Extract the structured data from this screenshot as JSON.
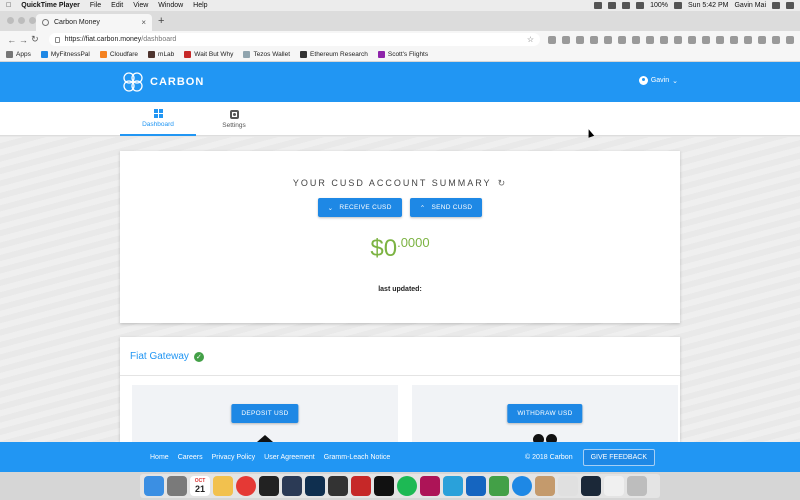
{
  "menubar": {
    "apple": "",
    "app_name": "QuickTime Player",
    "items": [
      "File",
      "Edit",
      "View",
      "Window",
      "Help"
    ],
    "battery": "100%",
    "clock": "Sun 5:42 PM",
    "user": "Gavin Mai"
  },
  "browser": {
    "tab_title": "Carbon Money",
    "tab_close": "×",
    "new_tab": "+",
    "url_host": "https://fiat.carbon.money",
    "url_path": "/dashboard",
    "bookmarks": [
      {
        "label": "Apps",
        "color": "#777777"
      },
      {
        "label": "MyFitnessPal",
        "color": "#1e88e5"
      },
      {
        "label": "Cloudfare",
        "color": "#f48120"
      },
      {
        "label": "mLab",
        "color": "#4e342e"
      },
      {
        "label": "Wait But Why",
        "color": "#c62828"
      },
      {
        "label": "Tezos Wallet",
        "color": "#90a4ae"
      },
      {
        "label": "Ethereum Research",
        "color": "#333333"
      },
      {
        "label": "Scott's Flights",
        "color": "#8e24aa"
      }
    ]
  },
  "header": {
    "logo_text": "CARBON",
    "user_name": "Gavin",
    "brand_color": "#2196f3"
  },
  "subnav": {
    "tabs": [
      {
        "label": "Dashboard",
        "icon": "dashboard-icon",
        "active": true
      },
      {
        "label": "Settings",
        "icon": "settings-icon",
        "active": false
      }
    ]
  },
  "summary": {
    "title": "YOUR CUSD ACCOUNT SUMMARY",
    "receive_label": "RECEIVE CUSD",
    "send_label": "SEND CUSD",
    "balance_main": "$0",
    "balance_decimals": ".0000",
    "last_updated_label": "last updated:",
    "balance_color": "#7cb342"
  },
  "fiat": {
    "title": "Fiat Gateway",
    "deposit_label": "DEPOSIT USD",
    "withdraw_label": "WITHDRAW USD"
  },
  "footer": {
    "links": [
      "Home",
      "Careers",
      "Privacy Policy",
      "User Agreement",
      "Gramm-Leach Notice"
    ],
    "copyright": "© 2018 Carbon",
    "feedback_label": "GIVE FEEDBACK"
  },
  "dock": {
    "calendar_month": "OCT",
    "calendar_day": "21",
    "apps": [
      "finder",
      "launchpad",
      "calendar",
      "photos",
      "chrome",
      "terminal",
      "lightroom",
      "photoshop",
      "live",
      "acrobat",
      "jx",
      "spotify",
      "app",
      "telegram",
      "vscode",
      "mongodb",
      "safari",
      "app",
      "app",
      "steam",
      "app",
      "trash"
    ]
  }
}
